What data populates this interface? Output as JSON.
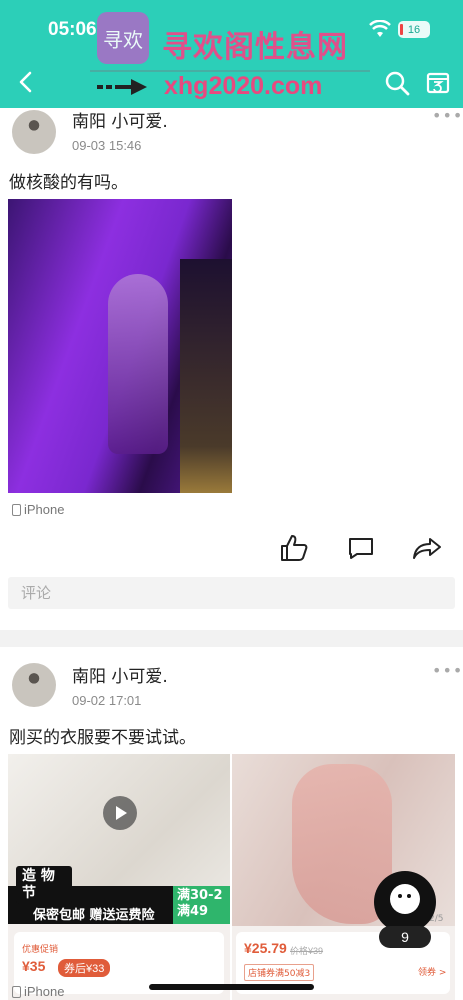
{
  "status_bar": {
    "time": "05:06",
    "battery": "16"
  },
  "watermark": {
    "logo_text": "寻欢",
    "title": "寻欢阁性息网",
    "url": "xhg2020.com"
  },
  "posts": [
    {
      "username": "南阳  小可爱.",
      "timestamp": "09-03 15:46",
      "text": "做核酸的有吗。",
      "source": "iPhone",
      "comment_placeholder": "评论"
    },
    {
      "username": "南阳  小可爱.",
      "timestamp": "09-02 17:01",
      "text": "刚买的衣服要不要试试。",
      "source": "iPhone",
      "ad_left": {
        "tag": "造 物 节",
        "banner": "保密包邮  赠送运费险",
        "promo": "满30-2 满49",
        "coupon_label": "优惠促销",
        "price": "¥35",
        "badge": "券后¥33"
      },
      "ad_right": {
        "price": "¥25.79",
        "original_price": "价格¥39",
        "coupon": "店铺券满50减3",
        "collect": "领券 >",
        "page": "2/5"
      }
    }
  ],
  "fab": {
    "count": "9"
  }
}
